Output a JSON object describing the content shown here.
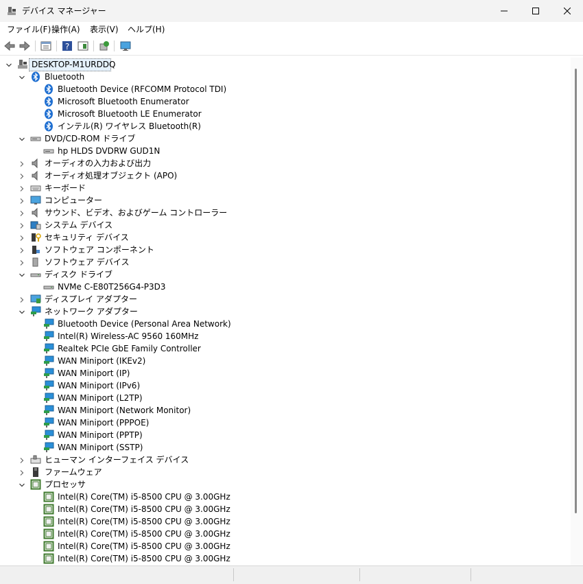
{
  "window": {
    "title": "デバイス マネージャー"
  },
  "menu": [
    {
      "label": "ファイル(F)"
    },
    {
      "label": "操作(A)"
    },
    {
      "label": "表示(V)"
    },
    {
      "label": "ヘルプ(H)"
    }
  ],
  "toolbar": [
    "back-icon",
    "forward-icon",
    "properties-icon",
    "help-icon",
    "view-icon",
    "scan-icon",
    "monitor-icon"
  ],
  "tree": {
    "root": "DESKTOP-M1URDDQ",
    "categories": [
      {
        "label": "Bluetooth",
        "icon": "bluetooth-icon",
        "expanded": true,
        "children": [
          {
            "label": "Bluetooth Device (RFCOMM Protocol TDI)",
            "icon": "bluetooth-icon"
          },
          {
            "label": "Microsoft Bluetooth Enumerator",
            "icon": "bluetooth-icon"
          },
          {
            "label": "Microsoft Bluetooth LE Enumerator",
            "icon": "bluetooth-icon"
          },
          {
            "label": "インテル(R) ワイヤレス Bluetooth(R)",
            "icon": "bluetooth-icon"
          }
        ]
      },
      {
        "label": "DVD/CD-ROM ドライブ",
        "icon": "dvd-drive-icon",
        "expanded": true,
        "children": [
          {
            "label": "hp HLDS DVDRW  GUD1N",
            "icon": "dvd-drive-icon"
          }
        ]
      },
      {
        "label": "オーディオの入力および出力",
        "icon": "speaker-icon",
        "expanded": false
      },
      {
        "label": "オーディオ処理オブジェクト (APO)",
        "icon": "speaker-icon",
        "expanded": false
      },
      {
        "label": "キーボード",
        "icon": "keyboard-icon",
        "expanded": false
      },
      {
        "label": "コンピューター",
        "icon": "computer-icon",
        "expanded": false
      },
      {
        "label": "サウンド、ビデオ、およびゲーム コントローラー",
        "icon": "speaker-icon",
        "expanded": false
      },
      {
        "label": "システム デバイス",
        "icon": "system-device-icon",
        "expanded": false
      },
      {
        "label": "セキュリティ デバイス",
        "icon": "security-device-icon",
        "expanded": false
      },
      {
        "label": "ソフトウェア コンポーネント",
        "icon": "software-component-icon",
        "expanded": false
      },
      {
        "label": "ソフトウェア デバイス",
        "icon": "software-device-icon",
        "expanded": false
      },
      {
        "label": "ディスク ドライブ",
        "icon": "disk-drive-icon",
        "expanded": true,
        "children": [
          {
            "label": "NVMe C-E80T256G4-P3D3",
            "icon": "disk-drive-icon"
          }
        ]
      },
      {
        "label": "ディスプレイ アダプター",
        "icon": "display-adapter-icon",
        "expanded": false
      },
      {
        "label": "ネットワーク アダプター",
        "icon": "network-adapter-icon",
        "expanded": true,
        "children": [
          {
            "label": "Bluetooth Device (Personal Area Network)",
            "icon": "network-adapter-icon"
          },
          {
            "label": "Intel(R) Wireless-AC 9560 160MHz",
            "icon": "network-adapter-icon"
          },
          {
            "label": "Realtek PCIe GbE Family Controller",
            "icon": "network-adapter-icon"
          },
          {
            "label": "WAN Miniport (IKEv2)",
            "icon": "network-adapter-icon"
          },
          {
            "label": "WAN Miniport (IP)",
            "icon": "network-adapter-icon"
          },
          {
            "label": "WAN Miniport (IPv6)",
            "icon": "network-adapter-icon"
          },
          {
            "label": "WAN Miniport (L2TP)",
            "icon": "network-adapter-icon"
          },
          {
            "label": "WAN Miniport (Network Monitor)",
            "icon": "network-adapter-icon"
          },
          {
            "label": "WAN Miniport (PPPOE)",
            "icon": "network-adapter-icon"
          },
          {
            "label": "WAN Miniport (PPTP)",
            "icon": "network-adapter-icon"
          },
          {
            "label": "WAN Miniport (SSTP)",
            "icon": "network-adapter-icon"
          }
        ]
      },
      {
        "label": "ヒューマン インターフェイス デバイス",
        "icon": "hid-icon",
        "expanded": false
      },
      {
        "label": "ファームウェア",
        "icon": "firmware-icon",
        "expanded": false
      },
      {
        "label": "プロセッサ",
        "icon": "processor-icon",
        "expanded": true,
        "children": [
          {
            "label": "Intel(R) Core(TM) i5-8500 CPU @ 3.00GHz",
            "icon": "processor-icon"
          },
          {
            "label": "Intel(R) Core(TM) i5-8500 CPU @ 3.00GHz",
            "icon": "processor-icon"
          },
          {
            "label": "Intel(R) Core(TM) i5-8500 CPU @ 3.00GHz",
            "icon": "processor-icon"
          },
          {
            "label": "Intel(R) Core(TM) i5-8500 CPU @ 3.00GHz",
            "icon": "processor-icon"
          },
          {
            "label": "Intel(R) Core(TM) i5-8500 CPU @ 3.00GHz",
            "icon": "processor-icon"
          },
          {
            "label": "Intel(R) Core(TM) i5-8500 CPU @ 3.00GHz",
            "icon": "processor-icon"
          }
        ]
      }
    ]
  },
  "colors": {
    "bluetooth": "#1f6fd1",
    "network": "#2a8fd8",
    "processor": "#3f7a2e",
    "selection": "#e5f1fb"
  }
}
